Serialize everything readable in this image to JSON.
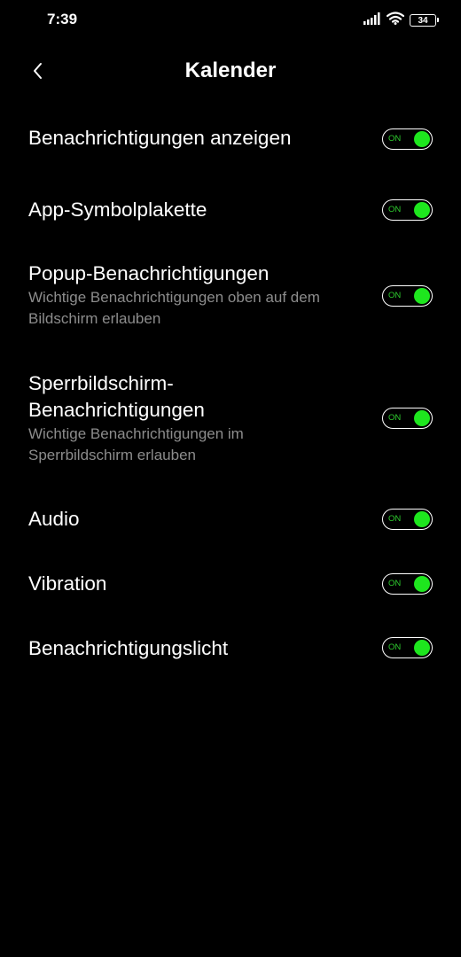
{
  "status_bar": {
    "time": "7:39",
    "battery": "34",
    "icons": [
      "signal-icon",
      "wifi-icon",
      "battery-icon"
    ]
  },
  "header": {
    "title": "Kalender",
    "back_icon": "chevron-left-icon"
  },
  "settings": [
    {
      "title": "Benachrichtigungen anzeigen",
      "description": "",
      "toggle_label": "ON",
      "enabled": true
    },
    {
      "title": "App-Symbolplakette",
      "description": "",
      "toggle_label": "ON",
      "enabled": true
    },
    {
      "title": "Popup-Benachrichtigungen",
      "description": "Wichtige Benachrichtigungen oben auf dem Bildschirm erlauben",
      "toggle_label": "ON",
      "enabled": true
    },
    {
      "title": "Sperrbildschirm-Benachrichtigungen",
      "description": "Wichtige Benachrichtigungen im Sperrbildschirm erlauben",
      "toggle_label": "ON",
      "enabled": true
    },
    {
      "title": "Audio",
      "description": "",
      "toggle_label": "ON",
      "enabled": true
    },
    {
      "title": "Vibration",
      "description": "",
      "toggle_label": "ON",
      "enabled": true
    },
    {
      "title": "Benachrichtigungslicht",
      "description": "",
      "toggle_label": "ON",
      "enabled": true
    }
  ],
  "colors": {
    "background": "#000000",
    "text_primary": "#ffffff",
    "text_secondary": "#8c8c8c",
    "toggle_on": "#1ee61e"
  }
}
